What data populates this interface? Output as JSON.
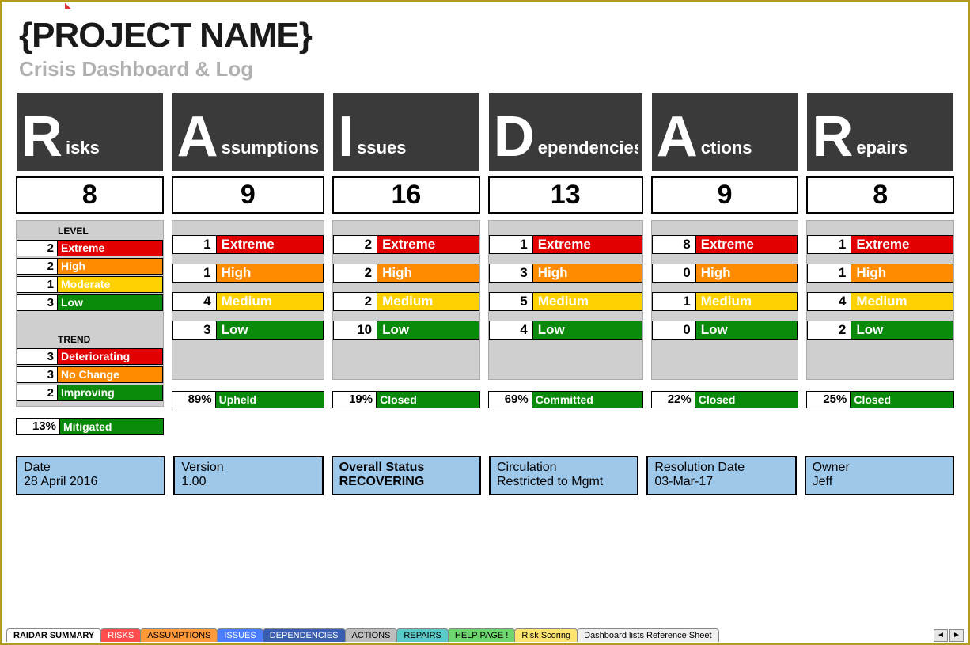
{
  "header": {
    "title": "{PROJECT NAME}",
    "subtitle": "Crisis Dashboard & Log"
  },
  "columns": [
    {
      "big": "R",
      "rest": "isks",
      "total": "8",
      "section_label_level": "LEVEL",
      "levels": [
        {
          "n": "2",
          "label": "Extreme",
          "cls": "c-extreme"
        },
        {
          "n": "2",
          "label": "High",
          "cls": "c-high"
        },
        {
          "n": "1",
          "label": "Moderate",
          "cls": "c-moderate"
        },
        {
          "n": "3",
          "label": "Low",
          "cls": "c-low"
        }
      ],
      "section_label_trend": "TREND",
      "trends": [
        {
          "n": "3",
          "label": "Deteriorating",
          "cls": "c-deter"
        },
        {
          "n": "3",
          "label": "No Change",
          "cls": "c-nochg"
        },
        {
          "n": "2",
          "label": "Improving",
          "cls": "c-improve"
        }
      ],
      "summary": {
        "pct": "13%",
        "label": "Mitigated"
      }
    },
    {
      "big": "A",
      "rest": "ssumptions",
      "total": "9",
      "big_levels": [
        {
          "n": "1",
          "label": "Extreme",
          "cls": "c-extreme"
        },
        {
          "n": "1",
          "label": "High",
          "cls": "c-high"
        },
        {
          "n": "4",
          "label": "Medium",
          "cls": "c-moderate"
        },
        {
          "n": "3",
          "label": "Low",
          "cls": "c-low"
        }
      ],
      "summary": {
        "pct": "89%",
        "label": "Upheld"
      }
    },
    {
      "big": "I",
      "rest": "ssues",
      "total": "16",
      "big_levels": [
        {
          "n": "2",
          "label": "Extreme",
          "cls": "c-extreme"
        },
        {
          "n": "2",
          "label": "High",
          "cls": "c-high"
        },
        {
          "n": "2",
          "label": "Medium",
          "cls": "c-moderate"
        },
        {
          "n": "10",
          "label": "Low",
          "cls": "c-low"
        }
      ],
      "summary": {
        "pct": "19%",
        "label": "Closed"
      }
    },
    {
      "big": "D",
      "rest": "ependencies",
      "total": "13",
      "big_levels": [
        {
          "n": "1",
          "label": "Extreme",
          "cls": "c-extreme"
        },
        {
          "n": "3",
          "label": "High",
          "cls": "c-high"
        },
        {
          "n": "5",
          "label": "Medium",
          "cls": "c-moderate"
        },
        {
          "n": "4",
          "label": "Low",
          "cls": "c-low"
        }
      ],
      "summary": {
        "pct": "69%",
        "label": "Committed"
      }
    },
    {
      "big": "A",
      "rest": "ctions",
      "total": "9",
      "big_levels": [
        {
          "n": "8",
          "label": "Extreme",
          "cls": "c-extreme"
        },
        {
          "n": "0",
          "label": "High",
          "cls": "c-high"
        },
        {
          "n": "1",
          "label": "Medium",
          "cls": "c-moderate"
        },
        {
          "n": "0",
          "label": "Low",
          "cls": "c-low"
        }
      ],
      "summary": {
        "pct": "22%",
        "label": "Closed"
      }
    },
    {
      "big": "R",
      "rest": "epairs",
      "total": "8",
      "big_levels": [
        {
          "n": "1",
          "label": "Extreme",
          "cls": "c-extreme"
        },
        {
          "n": "1",
          "label": "High",
          "cls": "c-high"
        },
        {
          "n": "4",
          "label": "Medium",
          "cls": "c-moderate"
        },
        {
          "n": "2",
          "label": "Low",
          "cls": "c-low"
        }
      ],
      "summary": {
        "pct": "25%",
        "label": "Closed"
      }
    }
  ],
  "info": [
    {
      "label": "Date",
      "value": "28 April 2016"
    },
    {
      "label": "Version",
      "value": "1.00"
    },
    {
      "label": "Overall Status",
      "value": "RECOVERING",
      "bold": true
    },
    {
      "label": "Circulation",
      "value": "Restricted to Mgmt"
    },
    {
      "label": "Resolution Date",
      "value": "03-Mar-17"
    },
    {
      "label": "Owner",
      "value": "Jeff"
    }
  ],
  "tabs": [
    {
      "label": "RAIDAR SUMMARY",
      "cls": "active"
    },
    {
      "label": "RISKS",
      "cls": "t-red"
    },
    {
      "label": "ASSUMPTIONS",
      "cls": "t-orange"
    },
    {
      "label": "ISSUES",
      "cls": "t-blue"
    },
    {
      "label": "DEPENDENCIES",
      "cls": "t-navy"
    },
    {
      "label": "ACTIONS",
      "cls": "t-grey"
    },
    {
      "label": "REPAIRS",
      "cls": "t-teal"
    },
    {
      "label": "HELP PAGE !",
      "cls": "t-green"
    },
    {
      "label": "Risk Scoring",
      "cls": "t-yellow"
    },
    {
      "label": "Dashboard lists Reference Sheet",
      "cls": "t-plain"
    }
  ]
}
